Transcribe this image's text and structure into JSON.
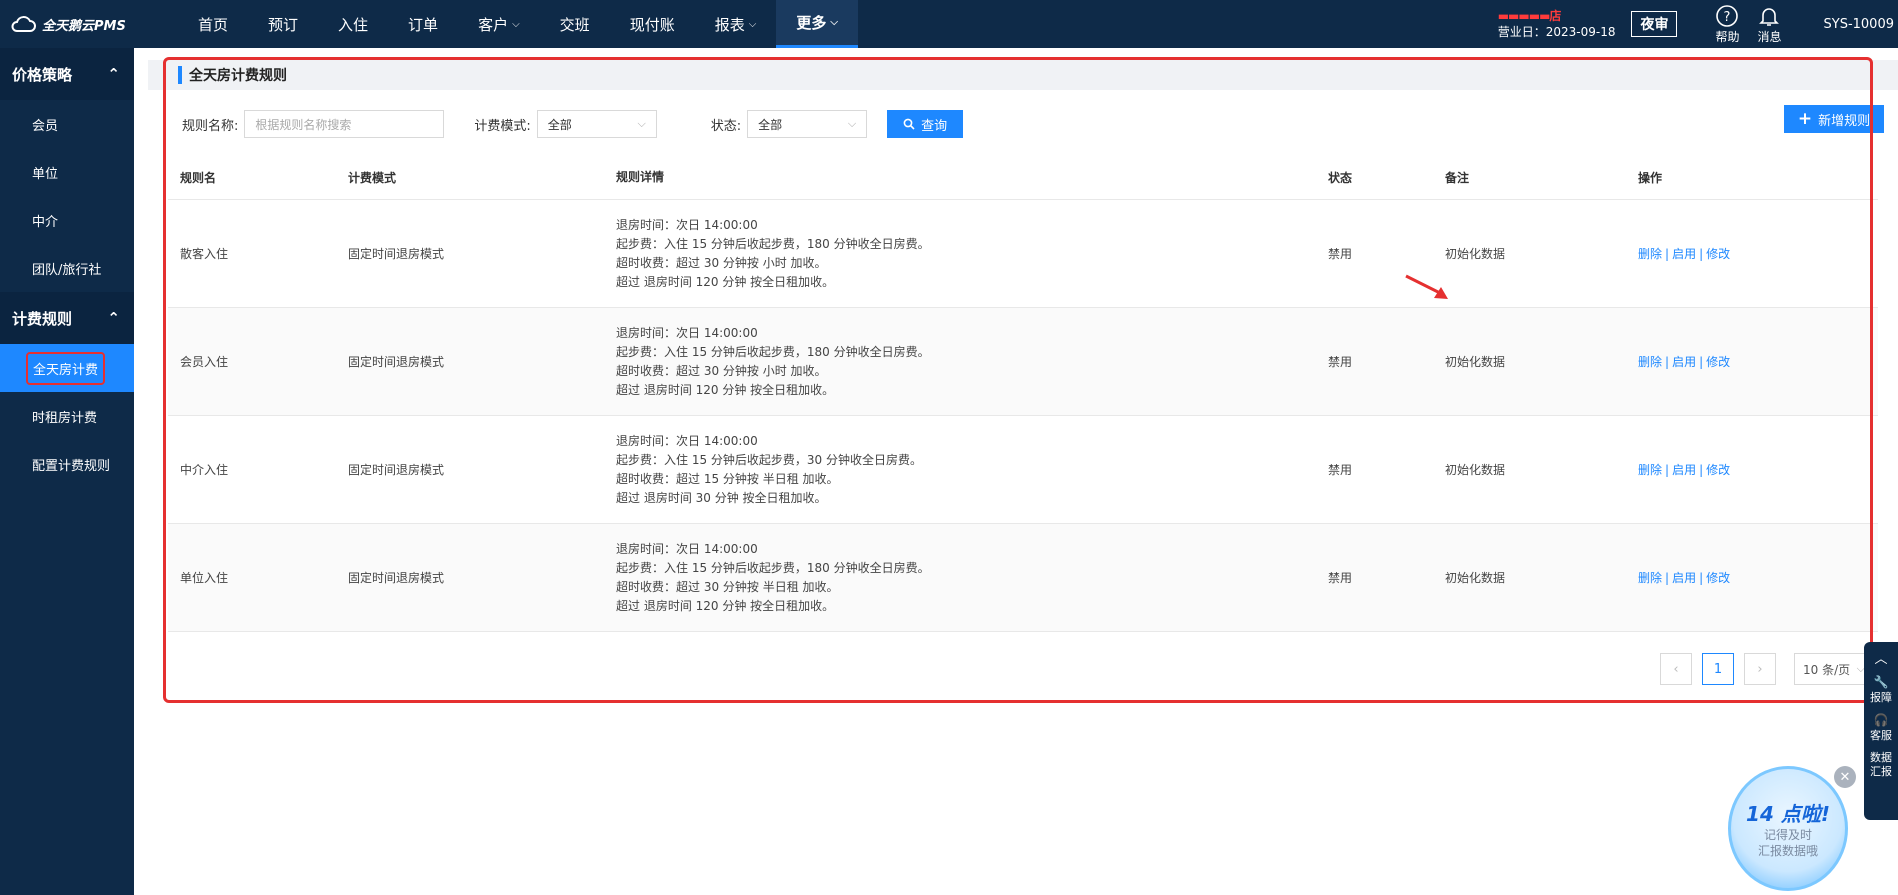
{
  "app": {
    "logo_text": "全天鹅云PMS"
  },
  "nav": {
    "items": [
      {
        "label": "首页",
        "has_menu": false
      },
      {
        "label": "预订",
        "has_menu": false
      },
      {
        "label": "入住",
        "has_menu": false
      },
      {
        "label": "订单",
        "has_menu": false
      },
      {
        "label": "客户",
        "has_menu": true
      },
      {
        "label": "交班",
        "has_menu": false
      },
      {
        "label": "现付账",
        "has_menu": false
      },
      {
        "label": "报表",
        "has_menu": true
      },
      {
        "label": "更多",
        "has_menu": true,
        "active": true
      }
    ],
    "hotel_name_redacted": "▬▬▬▬▬店",
    "business_date": "营业日：2023-09-18",
    "night_audit": "夜审",
    "help": "帮助",
    "messages": "消息",
    "user_code": "SYS-10009"
  },
  "sidebar": {
    "groups": [
      {
        "label": "价格策略",
        "items": [
          "会员",
          "单位",
          "中介",
          "团队/旅行社"
        ]
      },
      {
        "label": "计费规则",
        "items": [
          "全天房计费",
          "时租房计费",
          "配置计费规则"
        ]
      }
    ],
    "active_item": "全天房计费"
  },
  "page": {
    "title": "全天房计费规则",
    "filters": {
      "rule_name_label": "规则名称:",
      "rule_name_placeholder": "根据规则名称搜索",
      "mode_label": "计费模式:",
      "mode_value": "全部",
      "status_label": "状态:",
      "status_value": "全部",
      "query_button": "查询"
    },
    "add_button": "新增规则"
  },
  "table": {
    "headers": [
      "规则名",
      "计费模式",
      "规则详情",
      "状态",
      "备注",
      "操作"
    ],
    "rows": [
      {
        "name": "散客入住",
        "mode": "固定时间退房模式",
        "details": [
          "退房时间：次日 14:00:00",
          "起步费：入住 15 分钟后收起步费，180 分钟收全日房费。",
          "超时收费：超过 30 分钟按 小时 加收。",
          "超过 退房时间 120 分钟 按全日租加收。"
        ],
        "status": "禁用",
        "remark": "初始化数据",
        "ops": [
          "删除",
          "启用",
          "修改"
        ]
      },
      {
        "name": "会员入住",
        "mode": "固定时间退房模式",
        "details": [
          "退房时间：次日 14:00:00",
          "起步费：入住 15 分钟后收起步费，180 分钟收全日房费。",
          "超时收费：超过 30 分钟按 小时 加收。",
          "超过 退房时间 120 分钟 按全日租加收。"
        ],
        "status": "禁用",
        "remark": "初始化数据",
        "ops": [
          "删除",
          "启用",
          "修改"
        ]
      },
      {
        "name": "中介入住",
        "mode": "固定时间退房模式",
        "details": [
          "退房时间：次日 14:00:00",
          "起步费：入住 15 分钟后收起步费，30 分钟收全日房费。",
          "超时收费：超过 15 分钟按 半日租 加收。",
          "超过 退房时间 30 分钟 按全日租加收。"
        ],
        "status": "禁用",
        "remark": "初始化数据",
        "ops": [
          "删除",
          "启用",
          "修改"
        ]
      },
      {
        "name": "单位入住",
        "mode": "固定时间退房模式",
        "details": [
          "退房时间：次日 14:00:00",
          "起步费：入住 15 分钟后收起步费，180 分钟收全日房费。",
          "超时收费：超过 30 分钟按 半日租 加收。",
          "超过 退房时间 120 分钟 按全日租加收。"
        ],
        "status": "禁用",
        "remark": "初始化数据",
        "ops": [
          "删除",
          "启用",
          "修改"
        ]
      }
    ]
  },
  "pagination": {
    "current_page": "1",
    "page_size": "10 条/页"
  },
  "float_bar": {
    "items": [
      "报障",
      "客服",
      "数据汇报"
    ]
  },
  "promo": {
    "title": "14 点啦!",
    "line1": "记得及时",
    "line2": "汇报数据哦"
  },
  "colors": {
    "nav_bg": "#0e2a48",
    "accent": "#1e88ff",
    "highlight_red": "#e53030"
  }
}
